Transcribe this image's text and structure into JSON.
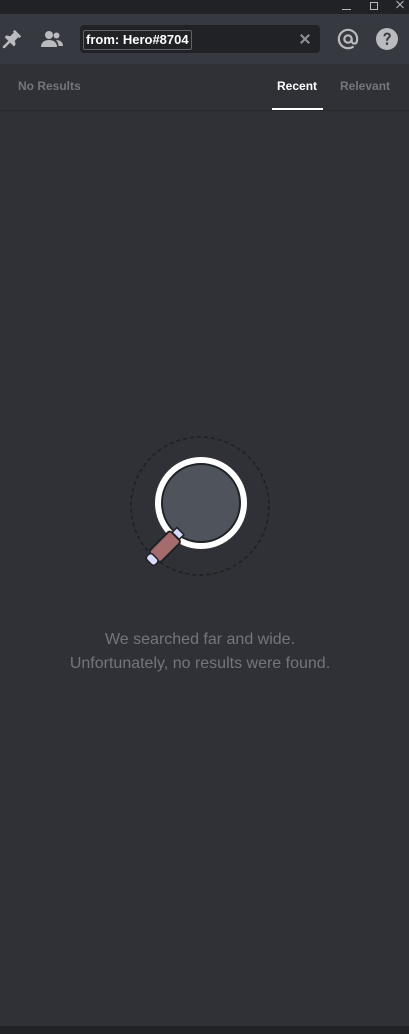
{
  "window_controls": {
    "minimize": "minimize-icon",
    "maximize": "maximize-icon",
    "close": "close-icon"
  },
  "toolbar": {
    "icons": {
      "pinned": "pin-icon",
      "members": "users-icon",
      "mentions": "at-sign-icon",
      "help": "question-icon"
    },
    "search": {
      "value": "from: Hero#8704",
      "clear_icon": "clear-x-icon"
    }
  },
  "results": {
    "count_label": "No Results",
    "tabs": [
      {
        "label": "Recent",
        "active": true
      },
      {
        "label": "Relevant",
        "active": false
      }
    ]
  },
  "empty_state": {
    "illustration": "magnifying-glass-icon",
    "line1": "We searched far and wide.",
    "line2": "Unfortunately, no results were found."
  },
  "colors": {
    "background": "#2f3136",
    "toolbar": "#36393f",
    "input": "#202225",
    "muted_text": "#72767d",
    "active_text": "#ffffff",
    "handle": "#a56c6e"
  }
}
